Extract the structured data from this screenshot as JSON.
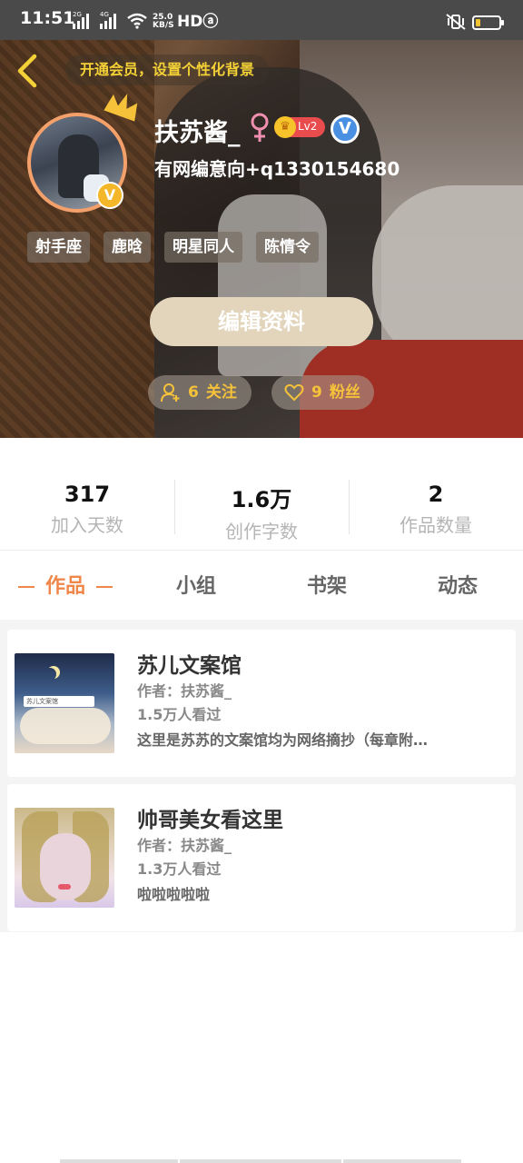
{
  "status_bar": {
    "time": "11:51",
    "signal_label_1": "2G",
    "signal_label_2": "4G",
    "speed_value": "25.0",
    "speed_unit": "KB/S",
    "hd_label": "HDⓐ",
    "battery_level_percent": 15
  },
  "header": {
    "vip_banner": "开通会员，设置个性化背景",
    "username": "扶苏酱_",
    "level": "Lv2",
    "verified_label": "V",
    "avatar_badge": "V",
    "bio": "有网编意向+q1330154680",
    "tags": [
      "射手座",
      "鹿晗",
      "明星同人",
      "陈情令"
    ],
    "edit_button": "编辑资料",
    "follow_count": "6",
    "follow_label": "关注",
    "fans_count": "9",
    "fans_label": "粉丝"
  },
  "stats": [
    {
      "value": "317",
      "label": "加入天数"
    },
    {
      "value": "1.6万",
      "label": "创作字数"
    },
    {
      "value": "2",
      "label": "作品数量"
    }
  ],
  "tabs": [
    {
      "label": "作品",
      "active": true
    },
    {
      "label": "小组",
      "active": false
    },
    {
      "label": "书架",
      "active": false
    },
    {
      "label": "动态",
      "active": false
    }
  ],
  "works": [
    {
      "title": "苏儿文案馆",
      "author": "作者：扶苏酱_",
      "views": "1.5万人看过",
      "desc": "这里是苏苏的文案馆均为网络摘抄（每章附…",
      "cover_text": "苏儿文案馆"
    },
    {
      "title": "帅哥美女看这里",
      "author": "作者：扶苏酱_",
      "views": "1.3万人看过",
      "desc": "啦啦啦啦啦"
    }
  ],
  "colors": {
    "accent": "#f0874a",
    "gold": "#f6c23a",
    "edit_button": "#e2d5bb"
  }
}
